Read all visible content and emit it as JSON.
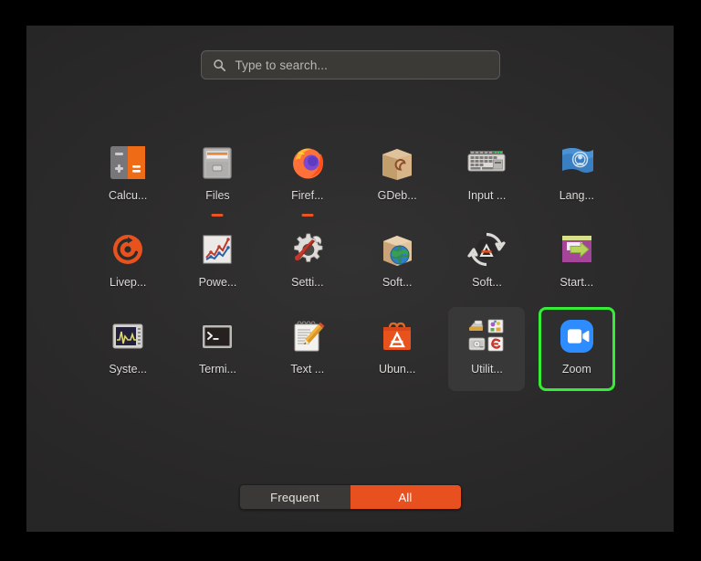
{
  "window": {
    "kind": "gnome-activities-overview",
    "panel_bg": "#2c2b2b",
    "frame_bg": "#000000"
  },
  "search": {
    "icon": "search-icon",
    "placeholder": "Type to search...",
    "value": ""
  },
  "apps": [
    {
      "label": "Calcu...",
      "full_name": "Calculator",
      "icon": "calculator-icon",
      "running": false,
      "selected": false,
      "folder": false
    },
    {
      "label": "Files",
      "full_name": "Files",
      "icon": "files-icon",
      "running": true,
      "selected": false,
      "folder": false
    },
    {
      "label": "Firef...",
      "full_name": "Firefox",
      "icon": "firefox-icon",
      "running": true,
      "selected": false,
      "folder": false
    },
    {
      "label": "GDeb...",
      "full_name": "GDebi Package Installer",
      "icon": "gdebi-package-icon",
      "running": false,
      "selected": false,
      "folder": false
    },
    {
      "label": "Input ...",
      "full_name": "Input Method",
      "icon": "keyboard-icon",
      "running": false,
      "selected": false,
      "folder": false
    },
    {
      "label": "Lang...",
      "full_name": "Language Support",
      "icon": "language-flag-icon",
      "running": false,
      "selected": false,
      "folder": false
    },
    {
      "label": "Livep...",
      "full_name": "Livepatch",
      "icon": "livepatch-icon",
      "running": false,
      "selected": false,
      "folder": false
    },
    {
      "label": "Powe...",
      "full_name": "Power Statistics",
      "icon": "power-statistics-icon",
      "running": false,
      "selected": false,
      "folder": false
    },
    {
      "label": "Setti...",
      "full_name": "Settings",
      "icon": "settings-gear-wrench-icon",
      "running": false,
      "selected": false,
      "folder": false
    },
    {
      "label": "Soft...",
      "full_name": "Software & Updates",
      "icon": "software-sources-icon",
      "running": false,
      "selected": false,
      "folder": false
    },
    {
      "label": "Soft...",
      "full_name": "Software Updater",
      "icon": "software-updater-icon",
      "running": false,
      "selected": false,
      "folder": false
    },
    {
      "label": "Start...",
      "full_name": "Startup Applications",
      "icon": "startup-applications-icon",
      "running": false,
      "selected": false,
      "folder": false
    },
    {
      "label": "Syste...",
      "full_name": "System Monitor",
      "icon": "system-monitor-icon",
      "running": false,
      "selected": false,
      "folder": false
    },
    {
      "label": "Termi...",
      "full_name": "Terminal",
      "icon": "terminal-icon",
      "running": false,
      "selected": false,
      "folder": false
    },
    {
      "label": "Text ...",
      "full_name": "Text Editor",
      "icon": "text-editor-icon",
      "running": false,
      "selected": false,
      "folder": false
    },
    {
      "label": "Ubun...",
      "full_name": "Ubuntu Software",
      "icon": "ubuntu-software-icon",
      "running": false,
      "selected": false,
      "folder": false
    },
    {
      "label": "Utilit...",
      "full_name": "Utilities",
      "icon": "utilities-folder-icon",
      "running": false,
      "selected": false,
      "folder": true
    },
    {
      "label": "Zoom",
      "full_name": "Zoom",
      "icon": "zoom-icon",
      "running": false,
      "selected": true,
      "folder": false
    }
  ],
  "view_toggle": {
    "options": [
      {
        "label": "Frequent",
        "active": false
      },
      {
        "label": "All",
        "active": true
      }
    ],
    "active_color": "#e8511f",
    "inactive_color": "#3a3937"
  },
  "selection": {
    "highlight_color": "#36ec36",
    "selected_app": "Zoom"
  },
  "accent": {
    "ubuntu_orange": "#e95420",
    "zoom_blue": "#2d8cff"
  }
}
